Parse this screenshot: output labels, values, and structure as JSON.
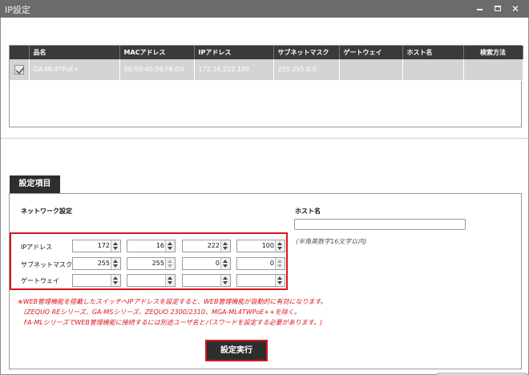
{
  "window": {
    "title": "IP設定"
  },
  "grid": {
    "columns": [
      "品名",
      "MACアドレス",
      "IPアドレス",
      "サブネットマスク",
      "ゲートウェイ",
      "ホスト名",
      "検索方法"
    ],
    "rows": [
      {
        "checked": true,
        "product": "GA-ML4TPoE+",
        "mac": "00:50:40:56:F6:D3",
        "ip": "172.16.222.100",
        "subnet": "255.255.0.0",
        "gateway": "",
        "host": "",
        "method": ""
      }
    ]
  },
  "settings": {
    "tab_label": "設定項目",
    "network_label": "ネットワーク設定",
    "host_label": "ホスト名",
    "host_value": "",
    "host_hint": "(半角英数字16文字以内)",
    "ip_label": "IPアドレス",
    "subnet_label": "サブネットマスク",
    "gateway_label": "ゲートウェイ",
    "ip": [
      "172",
      "16",
      "222",
      "100"
    ],
    "subnet": [
      "255",
      "255",
      "0",
      "0"
    ],
    "gateway": [
      "",
      "",
      "",
      ""
    ],
    "notes": [
      "※WEB管理機能を搭載したスイッチへIPアドレスを設定すると、WEB管理機能が自動的に有効になります。",
      "(ZEQUO REシリーズ、GA-MSシリーズ、ZEQUO 2300/2310、MGA-ML4TWPoE++を除く。",
      "FA-MLシリーズでWEB管理機能に接続するには別途ユーザ名とパスワードを設定する必要があります。)"
    ],
    "execute_label": "設定実行"
  }
}
